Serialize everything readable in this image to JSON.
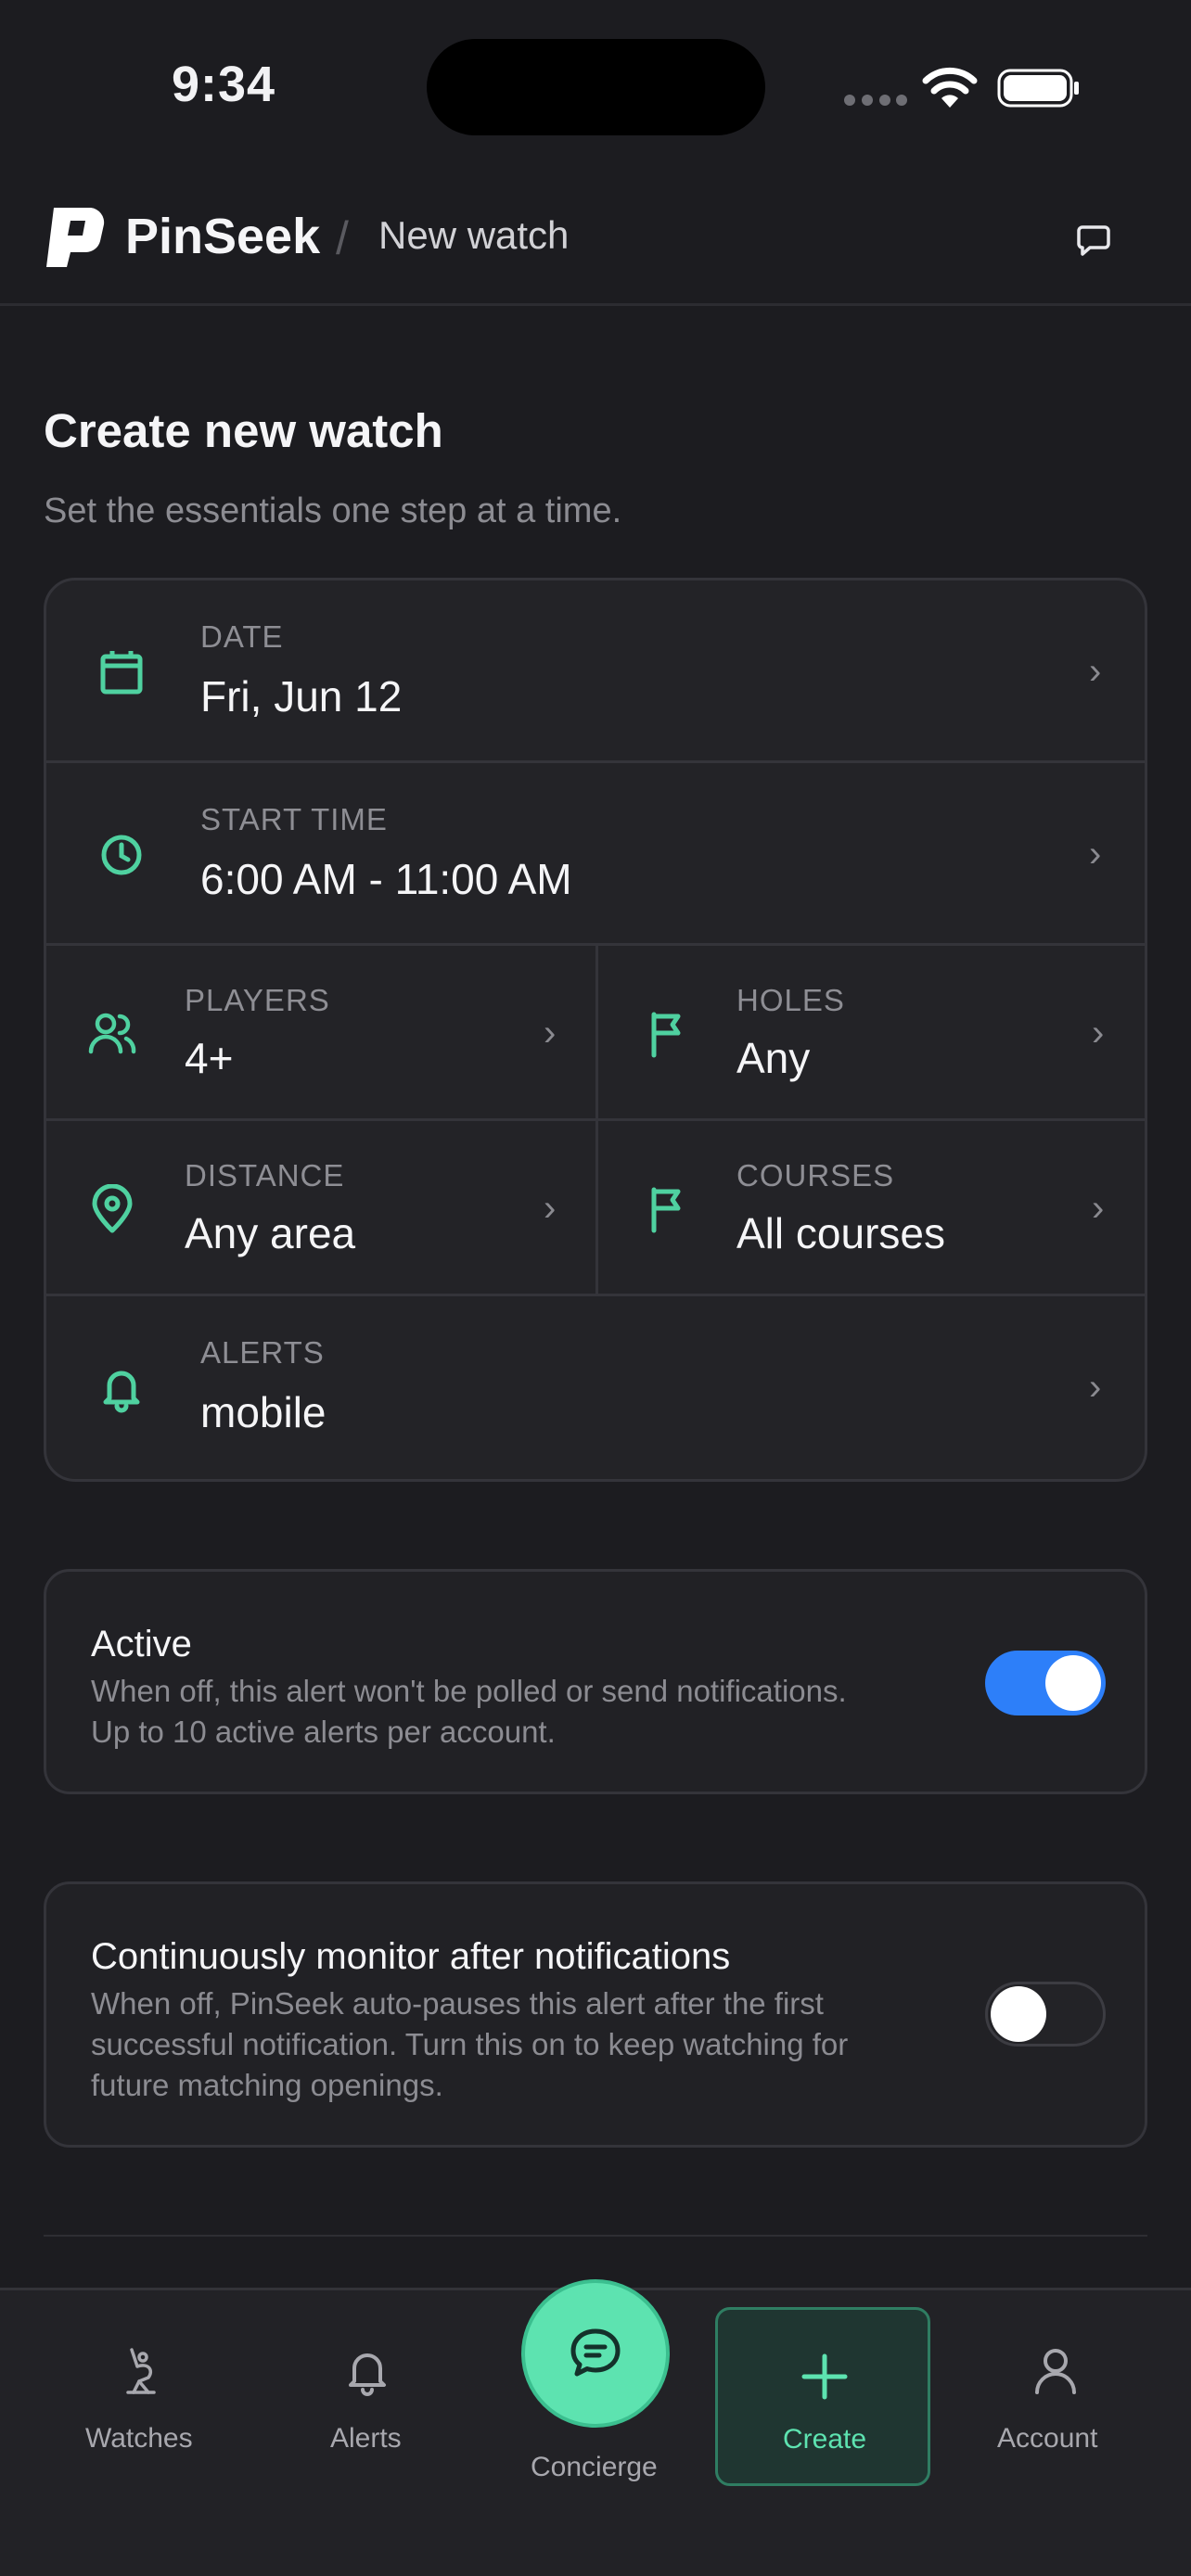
{
  "status": {
    "time": "9:34"
  },
  "header": {
    "brand": "PinSeek",
    "separator": "/",
    "crumb": "New watch"
  },
  "page": {
    "title": "Create new watch",
    "subtitle": "Set the essentials one step at a time."
  },
  "fields": {
    "date": {
      "label": "DATE",
      "value": "Fri, Jun 12"
    },
    "start_time": {
      "label": "START TIME",
      "value": "6:00 AM - 11:00 AM"
    },
    "players": {
      "label": "PLAYERS",
      "value": "4+"
    },
    "holes": {
      "label": "HOLES",
      "value": "Any"
    },
    "distance": {
      "label": "DISTANCE",
      "value": "Any area"
    },
    "courses": {
      "label": "COURSES",
      "value": "All courses"
    },
    "alerts": {
      "label": "ALERTS",
      "value": "mobile"
    },
    "chevron": "›"
  },
  "active": {
    "title": "Active",
    "desc_line1": "When off, this alert won't be polled or send notifications.",
    "desc_line2": "Up to 10 active alerts per account.",
    "enabled": true
  },
  "monitor": {
    "title": "Continuously monitor after notifications",
    "desc_line1": "When off, PinSeek auto-pauses this alert after the first",
    "desc_line2": "successful notification. Turn this on to keep watching for",
    "desc_line3": "future matching openings.",
    "enabled": false
  },
  "tabs": {
    "watches": "Watches",
    "alerts": "Alerts",
    "concierge": "Concierge",
    "create": "Create",
    "account": "Account"
  },
  "colors": {
    "accent_green": "#5de3b0",
    "icon_green": "#4fd1a0",
    "toggle_blue": "#2d7ff9",
    "background": "#1c1c20"
  }
}
